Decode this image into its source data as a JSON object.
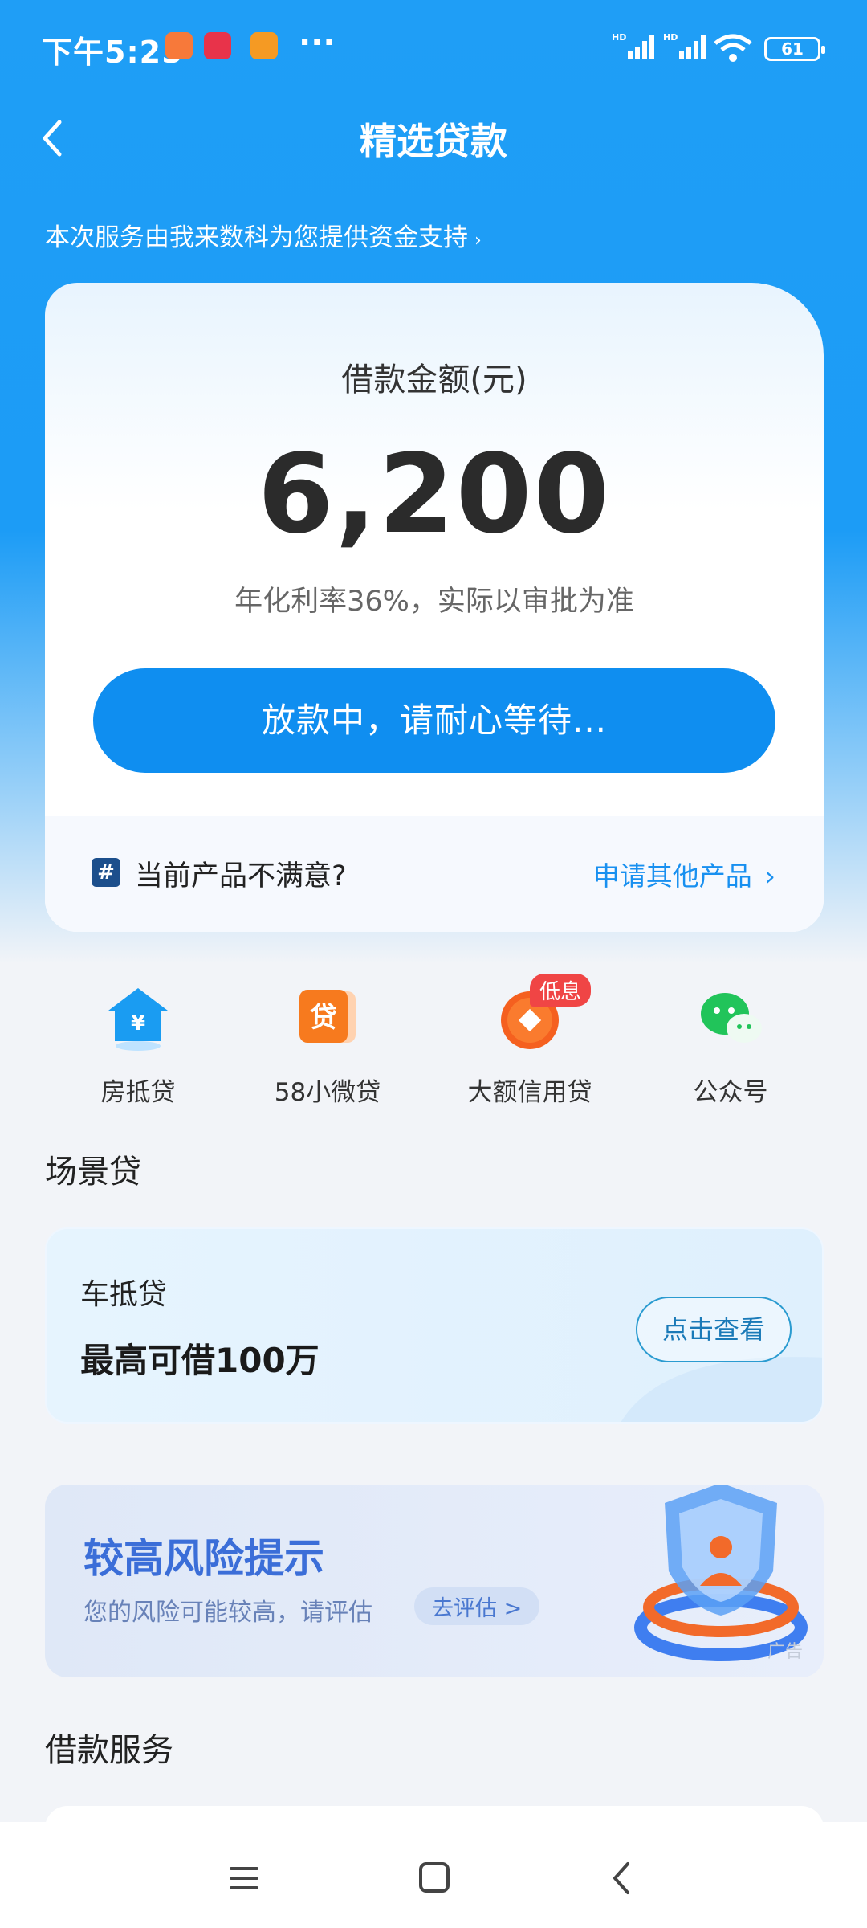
{
  "status": {
    "time": "下午5:25",
    "dots": "···",
    "battery": "61"
  },
  "nav": {
    "title": "精选贷款"
  },
  "provider": {
    "text": "本次服务由我来数科为您提供资金支持",
    "arrow": "›"
  },
  "loan_card": {
    "amount_label": "借款金额(元)",
    "amount": "6,200",
    "rate_text": "年化利率36%，实际以审批为准",
    "button_label": "放款中，请耐心等待...",
    "footer_icon": "#",
    "unsatisfied_text": "当前产品不满意?",
    "other_link": "申请其他产品",
    "other_chevron": "›"
  },
  "quick_links": [
    {
      "label": "房抵贷",
      "icon": "house-icon"
    },
    {
      "label": "58小微贷",
      "icon": "loan-icon"
    },
    {
      "label": "大额信用贷",
      "icon": "coin-icon",
      "badge": "低息"
    },
    {
      "label": "公众号",
      "icon": "wechat-icon"
    }
  ],
  "loan_card_icon_text": {
    "house": "¥",
    "loan": "贷"
  },
  "scene_section": {
    "title": "场景贷"
  },
  "scene_card": {
    "title": "车抵贷",
    "value": "最高可借100万",
    "button": "点击查看"
  },
  "ad": {
    "title": "较高风险提示",
    "subtitle": "您的风险可能较高，请评估",
    "button": "去评估 >",
    "tag": "广告"
  },
  "service_section": {
    "title": "借款服务"
  },
  "colors": {
    "primary": "#0f8ef0",
    "hero": "#1f9ef6",
    "badge": "#f04545",
    "ad_title": "#3b6ed8"
  }
}
